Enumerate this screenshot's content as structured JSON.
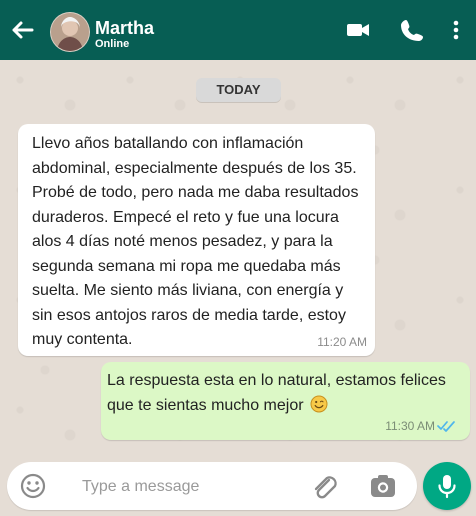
{
  "contact": {
    "name": "Martha",
    "status": "Online"
  },
  "chat": {
    "date": "TODAY",
    "incoming": {
      "text": "Llevo años batallando con inflamación abdominal, especialmente después de los 35. Probé de todo, pero nada me daba resultados duraderos. Empecé el reto y fue una locura alos 4 días noté menos pesadez, y para la segunda semana mi ropa me quedaba más suelta. Me siento más liviana, con energía y sin esos antojos raros de media tarde, estoy muy contenta.",
      "time": "11:20 AM"
    },
    "outgoing": {
      "text": "La respuesta esta en lo natural, estamos felices que te sientas mucho mejor",
      "time": "11:30 AM"
    }
  },
  "input": {
    "placeholder": "Type a message"
  },
  "colors": {
    "header": "#075e54",
    "incoming": "#ffffff",
    "outgoing": "#dcf8c6",
    "mic": "#00a884",
    "background": "#e5ddd5"
  },
  "icons": [
    "back-arrow-icon",
    "video-call-icon",
    "phone-icon",
    "more-vert-icon",
    "emoji-icon",
    "attachment-icon",
    "camera-icon",
    "microphone-icon",
    "double-check-icon",
    "smile-emoji-icon"
  ]
}
